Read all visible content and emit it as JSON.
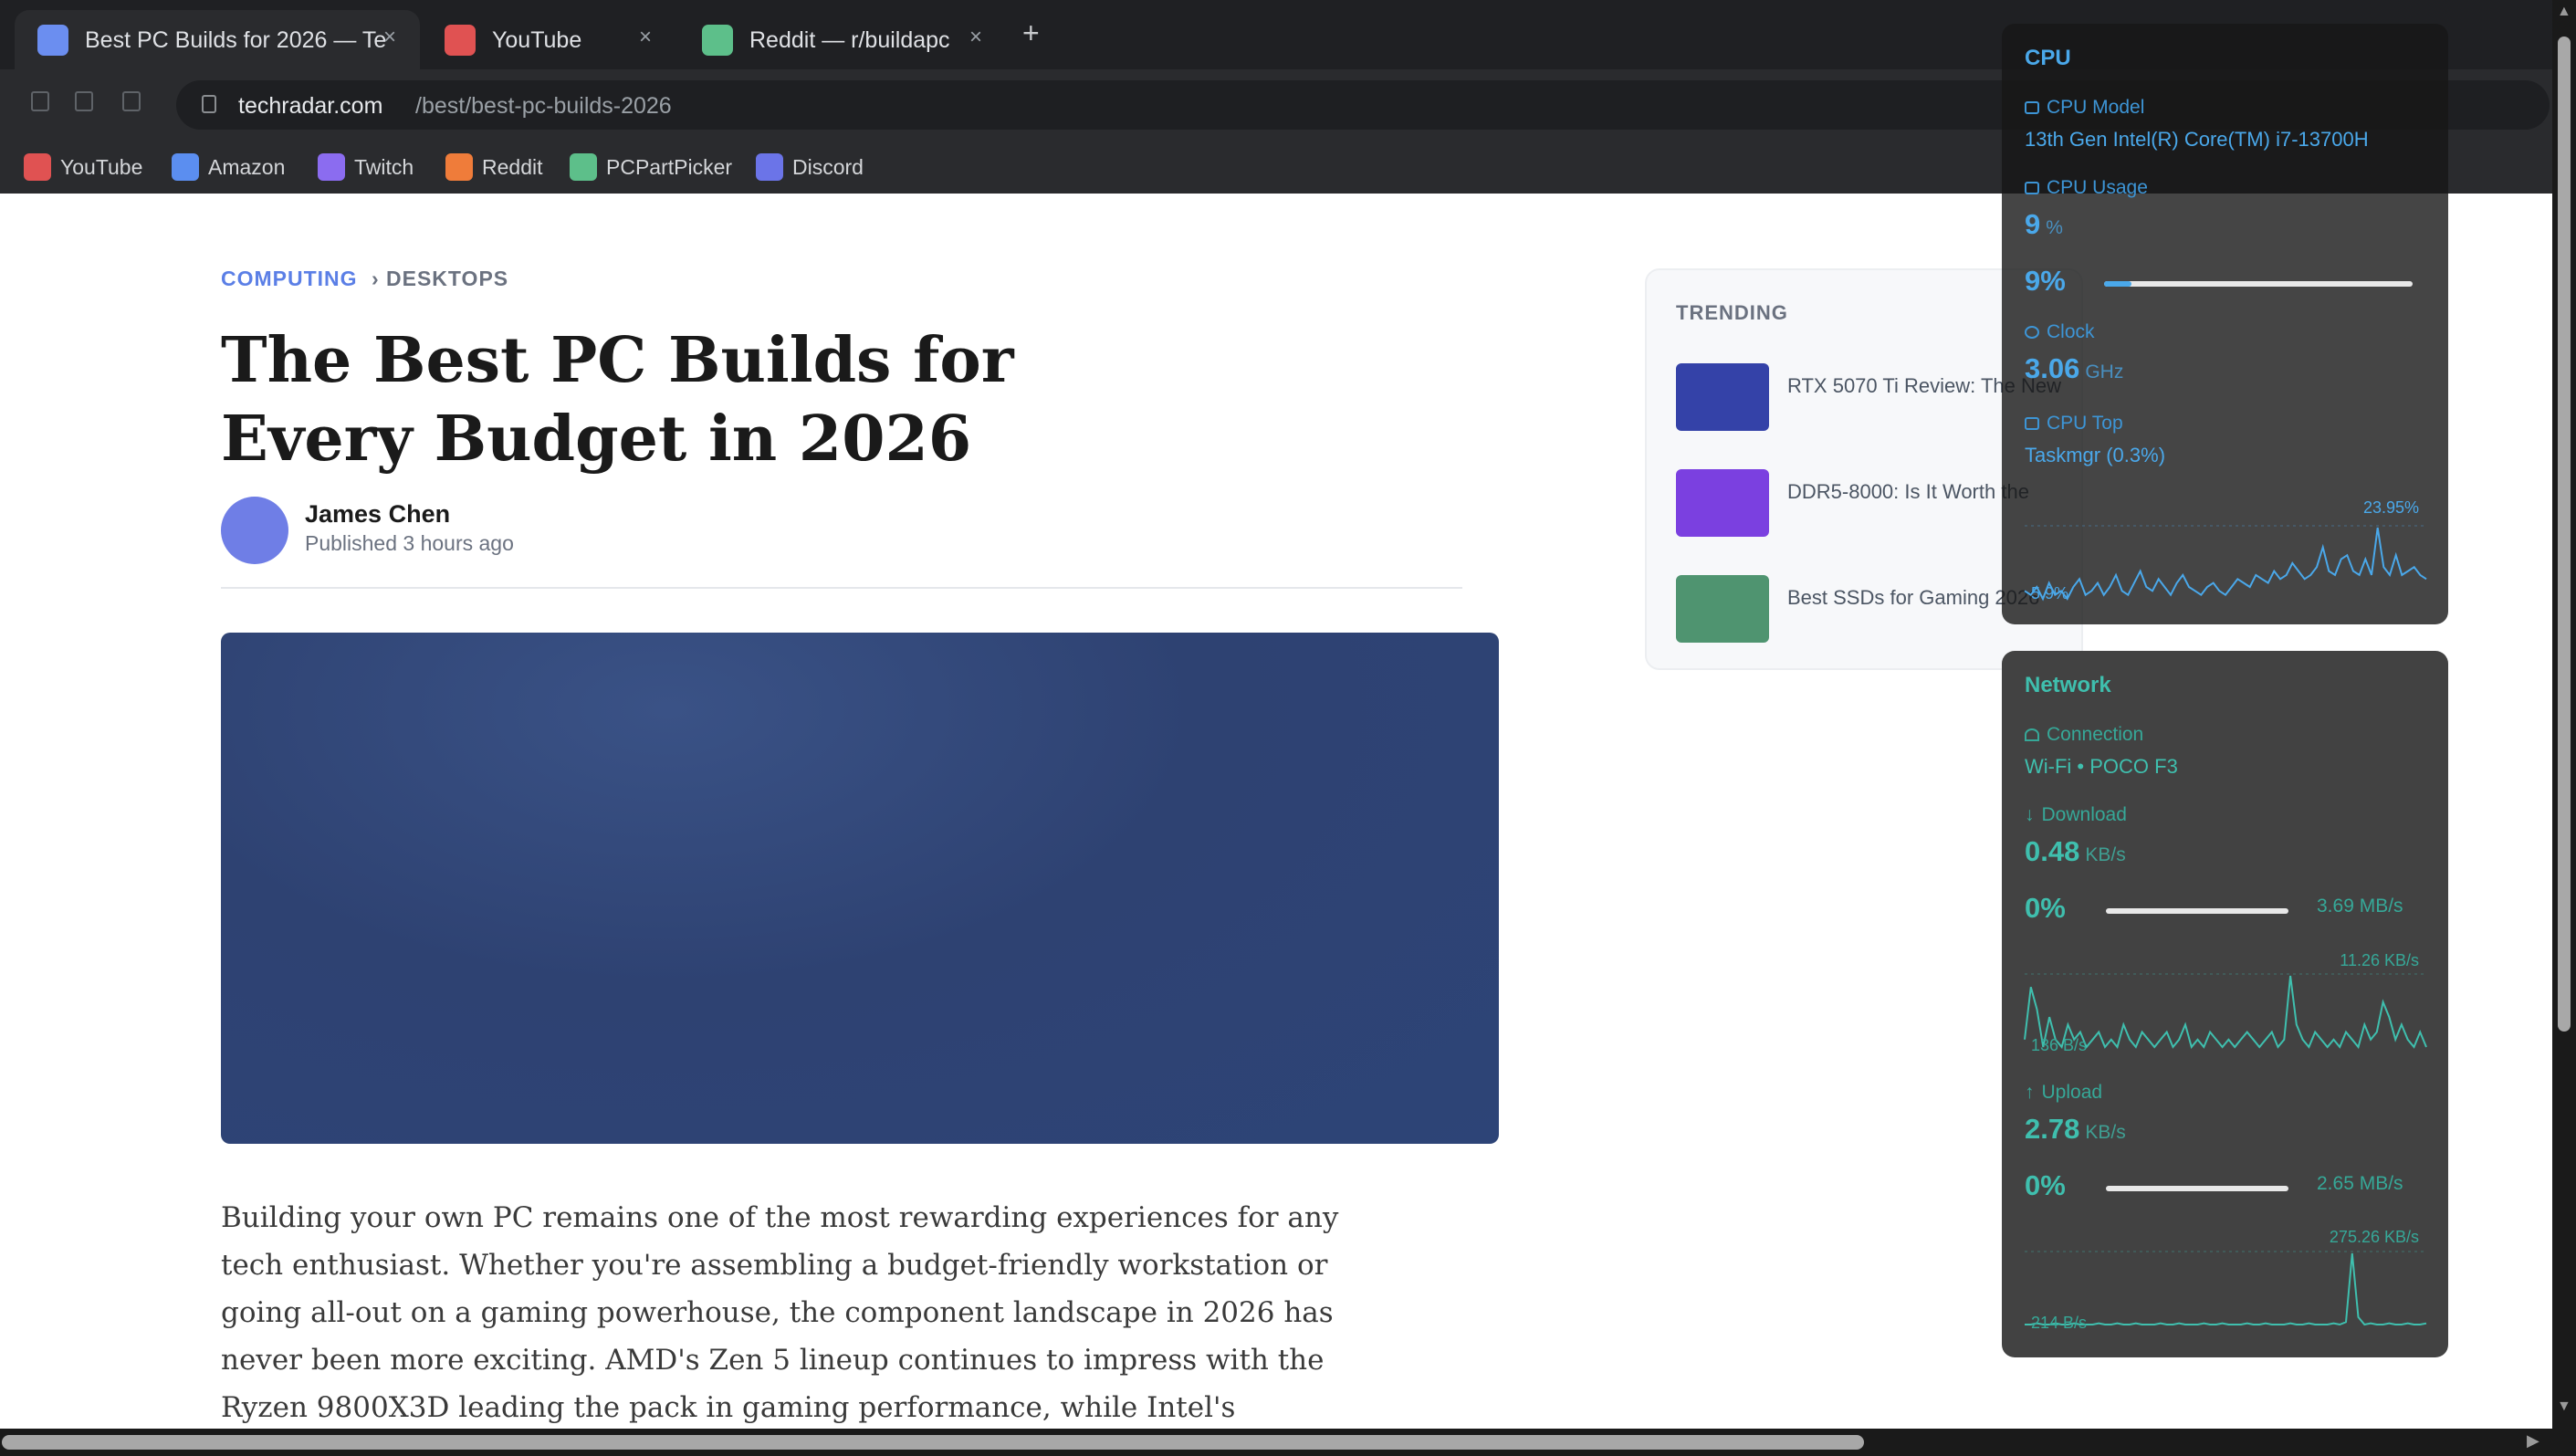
{
  "browser": {
    "tabs": [
      {
        "title": "Best PC Builds for 2026 — Te...",
        "favicon_color": "#6b8ef0",
        "close": "×",
        "active": true
      },
      {
        "title": "YouTube",
        "favicon_color": "#e05252",
        "close": "×",
        "active": false
      },
      {
        "title": "Reddit — r/buildapc",
        "favicon_color": "#5dbf8a",
        "close": "×",
        "active": false
      }
    ],
    "new_tab": "+",
    "url_host": "techradar.com",
    "url_path": "/best/best-pc-builds-2026",
    "bookmarks": [
      {
        "label": "YouTube",
        "color": "#e05252"
      },
      {
        "label": "Amazon",
        "color": "#5b8ef0"
      },
      {
        "label": "Twitch",
        "color": "#8b6cf0"
      },
      {
        "label": "Reddit",
        "color": "#ef7c3a"
      },
      {
        "label": "PCPartPicker",
        "color": "#5dbf8a"
      },
      {
        "label": "Discord",
        "color": "#6b74e8"
      }
    ]
  },
  "article": {
    "category": "COMPUTING",
    "separator": "›",
    "subcategory": "DESKTOPS",
    "headline": "The Best PC Builds for Every Budget in 2026",
    "author": "James Chen",
    "published": "Published 3 hours ago",
    "body": "Building your own PC remains one of the most rewarding experiences for any tech enthusiast. Whether you're assembling a budget-friendly workstation or going all-out on a gaming powerhouse, the component landscape in 2026 has never been more exciting. AMD's Zen 5 lineup continues to impress with the Ryzen 9800X3D leading the pack in gaming performance, while Intel's"
  },
  "trending": {
    "title": "TRENDING",
    "items": [
      {
        "label": "RTX 5070 Ti Review: The New",
        "color": "#3442a8"
      },
      {
        "label": "DDR5-8000: Is It Worth the",
        "color": "#7b40e0"
      },
      {
        "label": "Best SSDs for Gaming 2026",
        "color": "#4f9470"
      }
    ]
  },
  "cpu_widget": {
    "title": "CPU",
    "model_label": "CPU Model",
    "model_value": "13th Gen Intel(R) Core(TM) i7-13700H",
    "usage_label": "CPU Usage",
    "usage_value": "9",
    "usage_unit": "%",
    "usage_pct_text": "9%",
    "usage_fraction": 0.09,
    "clock_label": "Clock",
    "clock_value": "3.06",
    "clock_unit": "GHz",
    "top_label": "CPU Top",
    "top_value": "Taskmgr (0.3%)",
    "graph_max": "23.95%",
    "graph_min": "5.9%",
    "history": [
      8,
      7,
      9,
      6,
      10,
      7,
      8,
      6,
      9,
      11,
      7,
      8,
      10,
      7,
      9,
      12,
      8,
      7,
      10,
      13,
      9,
      8,
      11,
      9,
      7,
      10,
      12,
      9,
      8,
      7,
      9,
      10,
      8,
      7,
      9,
      11,
      10,
      9,
      12,
      11,
      10,
      13,
      11,
      12,
      15,
      13,
      11,
      12,
      14,
      19,
      13,
      12,
      16,
      17,
      13,
      12,
      16,
      12,
      23.95,
      14,
      12,
      17,
      12,
      13,
      14,
      12,
      11
    ]
  },
  "net_widget": {
    "title": "Network",
    "conn_label": "Connection",
    "conn_value": "Wi-Fi • POCO F3",
    "down_label": "Download",
    "down_value": "0.48",
    "down_unit": "KB/s",
    "down_pct": "0%",
    "down_fraction": 0,
    "down_max": "3.69 MB/s",
    "down_graph_max": "11.26 KB/s",
    "down_graph_min": "136 B/s",
    "down_history": [
      2,
      9,
      6,
      1,
      5,
      2,
      1,
      4,
      2,
      3,
      1,
      2,
      3,
      1,
      2,
      1,
      4,
      2,
      1,
      3,
      2,
      1,
      2,
      3,
      1,
      2,
      4,
      1,
      2,
      1,
      3,
      2,
      1,
      2,
      1,
      2,
      3,
      2,
      1,
      2,
      3,
      1,
      2,
      10.5,
      4,
      2,
      1,
      3,
      2,
      1,
      2,
      1,
      3,
      2,
      1,
      4,
      2,
      3,
      7,
      5,
      2,
      4,
      2,
      1,
      3,
      1
    ],
    "up_label": "Upload",
    "up_value": "2.78",
    "up_unit": "KB/s",
    "up_pct": "0%",
    "up_fraction": 0,
    "up_max": "2.65 MB/s",
    "up_graph_max": "275.26 KB/s",
    "up_graph_min": "214 B/s",
    "up_history": [
      2,
      2,
      3,
      2,
      2,
      3,
      2,
      2,
      3,
      2,
      2,
      2,
      3,
      2,
      2,
      3,
      2,
      2,
      3,
      2,
      2,
      2,
      3,
      2,
      2,
      3,
      2,
      2,
      2,
      3,
      2,
      2,
      3,
      2,
      2,
      2,
      3,
      2,
      2,
      3,
      2,
      2,
      2,
      3,
      2,
      2,
      3,
      2,
      2,
      2,
      3,
      2,
      4,
      60,
      8,
      2,
      3,
      2,
      2,
      3,
      2,
      2,
      3,
      2,
      2,
      3
    ]
  }
}
